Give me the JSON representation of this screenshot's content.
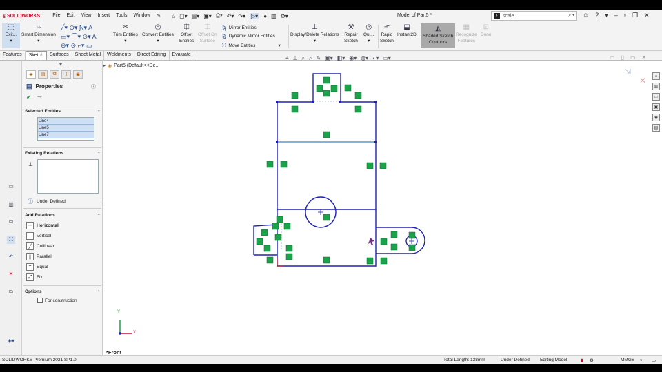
{
  "app": {
    "logo": "SOLIDWORKS",
    "doc_title": "Model of Part5 *"
  },
  "menu": [
    "File",
    "Edit",
    "View",
    "Insert",
    "Tools",
    "Window"
  ],
  "search": {
    "value": "scale"
  },
  "ribbon": {
    "exit_sketch": "Exit...",
    "smart_dimension": "Smart Dimension",
    "trim_entities": "Trim Entities",
    "convert_entities": "Convert Entities",
    "offset_entities_1": "Offset",
    "offset_entities_2": "Entities",
    "offset_on_surface_1": "Offset On",
    "offset_on_surface_2": "Surface",
    "mirror_entities": "Mirror Entities",
    "dynamic_mirror": "Dynamic Mirror Entities",
    "move_entities": "Move Entities",
    "display_delete_relations": "Display/Delete Relations",
    "repair_sketch_1": "Repair",
    "repair_sketch_2": "Sketch",
    "quick_snaps": "Qui...",
    "rapid_sketch_1": "Rapid",
    "rapid_sketch_2": "Sketch",
    "instant2d": "Instant2D",
    "shaded_contours_1": "Shaded Sketch",
    "shaded_contours_2": "Contours",
    "recognize_features_1": "Recognize",
    "recognize_features_2": "Features",
    "done": "Done"
  },
  "tabs": [
    "Features",
    "Sketch",
    "Surfaces",
    "Sheet Metal",
    "Weldments",
    "Direct Editing",
    "Evaluate"
  ],
  "tree": {
    "part": "Part5  (Default<<De..."
  },
  "properties": {
    "title": "Properties",
    "selected_entities_header": "Selected Entities",
    "selected_entities": [
      "Line4",
      "Line5",
      "Line7"
    ],
    "existing_relations_header": "Existing Relations",
    "status": "Under Defined",
    "add_relations_header": "Add Relations",
    "relations": [
      {
        "label": "Horizontal",
        "icon": "—"
      },
      {
        "label": "Vertical",
        "icon": "|"
      },
      {
        "label": "Collinear",
        "icon": "╱"
      },
      {
        "label": "Parallel",
        "icon": "∥"
      },
      {
        "label": "Equal",
        "icon": "="
      },
      {
        "label": "Fix",
        "icon": "⤢"
      }
    ],
    "options_header": "Options",
    "for_construction": "For construction"
  },
  "canvas": {
    "view_label": "*Front",
    "axis_x": "X",
    "axis_y": "Y"
  },
  "status": {
    "version": "SOLIDWORKS Premium 2021 SP1.0",
    "total_length": "Total Length: 138mm",
    "definition": "Under Defined",
    "mode": "Editing Model",
    "units": "MMGS"
  },
  "colors": {
    "sketch_line": "#1e22b4",
    "relation_marker": "#1aa34a",
    "selected_line": "#5a9ad2"
  }
}
